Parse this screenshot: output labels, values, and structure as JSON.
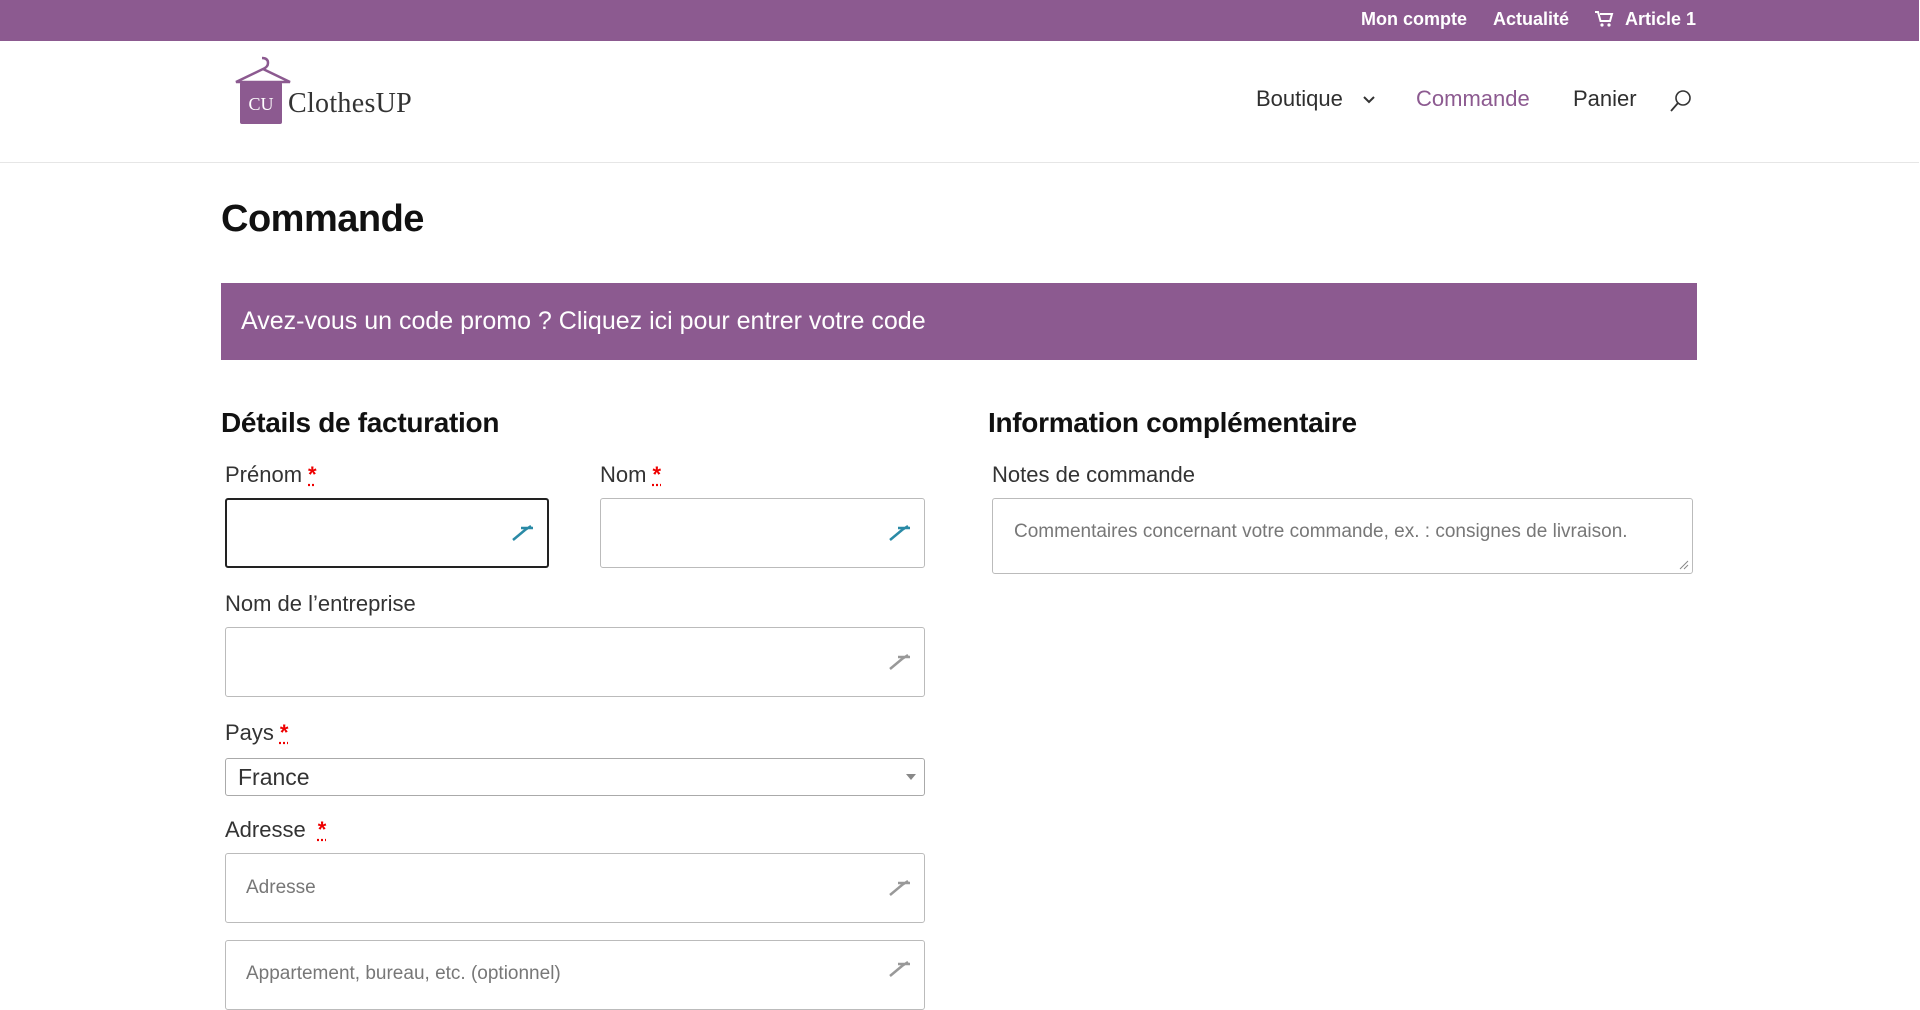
{
  "topbar": {
    "account": "Mon compte",
    "news": "Actualité",
    "cart": "Article 1"
  },
  "brand": {
    "name": "ClothesUP",
    "mark": "CU"
  },
  "nav": {
    "shop": "Boutique",
    "checkout": "Commande",
    "cart": "Panier"
  },
  "page": {
    "title": "Commande"
  },
  "promo": {
    "text": "Avez-vous un code promo ? Cliquez ici pour entrer votre code"
  },
  "billing": {
    "heading": "Détails de facturation",
    "required_mark": "*",
    "first_name_label": "Prénom",
    "first_name_value": "",
    "last_name_label": "Nom",
    "last_name_value": "",
    "company_label": "Nom de l’entreprise",
    "company_value": "",
    "country_label": "Pays",
    "country_value": "France",
    "address_label": "Adresse",
    "address_placeholder": "Adresse",
    "address2_placeholder": "Appartement, bureau, etc. (optionnel)"
  },
  "additional": {
    "heading": "Information complémentaire",
    "notes_label": "Notes de commande",
    "notes_placeholder": "Commentaires concernant votre commande, ex. : consignes de livraison."
  },
  "colors": {
    "brand": "#8c5a90",
    "required": "#e00000"
  },
  "icons": {
    "cart": "cart-icon",
    "search": "search-icon",
    "chevron": "chevron-down-icon",
    "autofill": "pen-icon"
  }
}
